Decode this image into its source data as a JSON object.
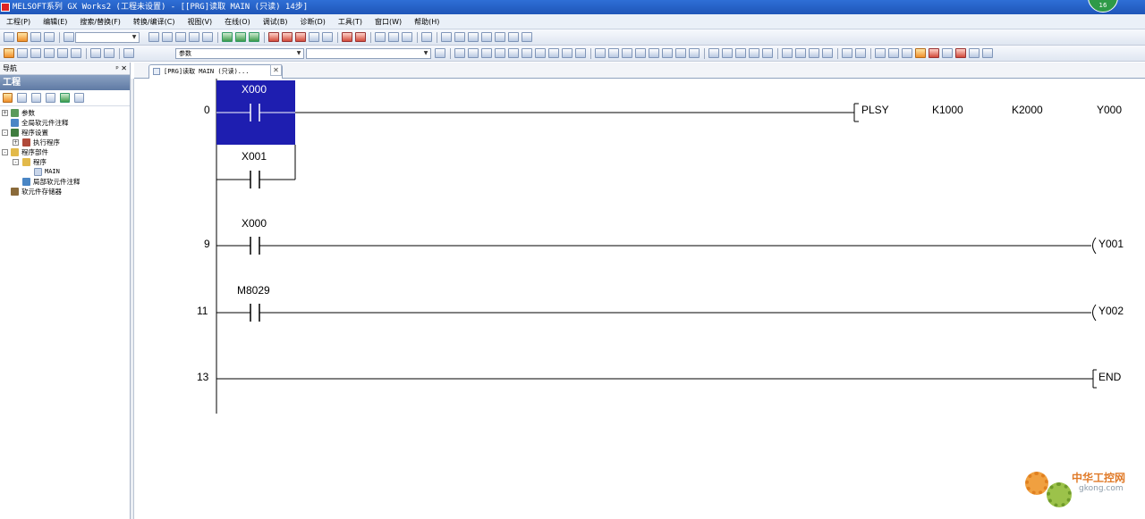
{
  "window": {
    "title": "MELSOFT系列 GX Works2 (工程未设置) - [[PRG]读取 MAIN (只读) 14步]",
    "badge": "16"
  },
  "menu": [
    "工程(P)",
    "编辑(E)",
    "搜索/替换(F)",
    "转换/编译(C)",
    "视图(V)",
    "在线(O)",
    "调试(B)",
    "诊断(D)",
    "工具(T)",
    "窗口(W)",
    "帮助(H)"
  ],
  "toolbar": {
    "combo1_value": "",
    "combo2_value": "参数",
    "combo3_value": ""
  },
  "navigation": {
    "header": "导航",
    "header_controls": "ᵖ ✕",
    "section": "工程",
    "tree": [
      {
        "label": "参数",
        "level": 0,
        "expander": "+",
        "icon": "parameter-icon"
      },
      {
        "label": "全局软元件注释",
        "level": 0,
        "expander": "",
        "icon": "global-device-comment-icon"
      },
      {
        "label": "程序设置",
        "level": 0,
        "expander": "-",
        "icon": "program-setting-icon"
      },
      {
        "label": "执行程序",
        "level": 1,
        "expander": "+",
        "icon": "execute-program-icon"
      },
      {
        "label": "程序部件",
        "level": 0,
        "expander": "-",
        "icon": "program-parts-folder-icon"
      },
      {
        "label": "程序",
        "level": 1,
        "expander": "-",
        "icon": "program-folder-icon"
      },
      {
        "label": "MAIN",
        "level": 2,
        "expander": "",
        "icon": "main-program-icon"
      },
      {
        "label": "局部软元件注释",
        "level": 1,
        "expander": "",
        "icon": "local-device-comment-icon"
      },
      {
        "label": "软元件存储器",
        "level": 0,
        "expander": "",
        "icon": "device-memory-icon"
      }
    ]
  },
  "editor": {
    "tab_label": "[PRG]读取 MAIN (只读)...",
    "tab_close": "✕",
    "rungs": [
      {
        "step": "0",
        "contacts": [
          "X000",
          "X001"
        ],
        "instruction": "PLSY",
        "operands": [
          "K1000",
          "K2000",
          "Y000"
        ]
      },
      {
        "step": "9",
        "contacts": [
          "X000"
        ],
        "coil": "Y001"
      },
      {
        "step": "11",
        "contacts": [
          "M8029"
        ],
        "coil": "Y002"
      },
      {
        "step": "13",
        "end": "END"
      }
    ]
  },
  "watermark": {
    "cn": "中华工控网",
    "en": "gkong.com"
  },
  "colors": {
    "title_bar": "#1f55b8",
    "selection": "#1e1eb0",
    "nav_section": "#6a84ad"
  }
}
